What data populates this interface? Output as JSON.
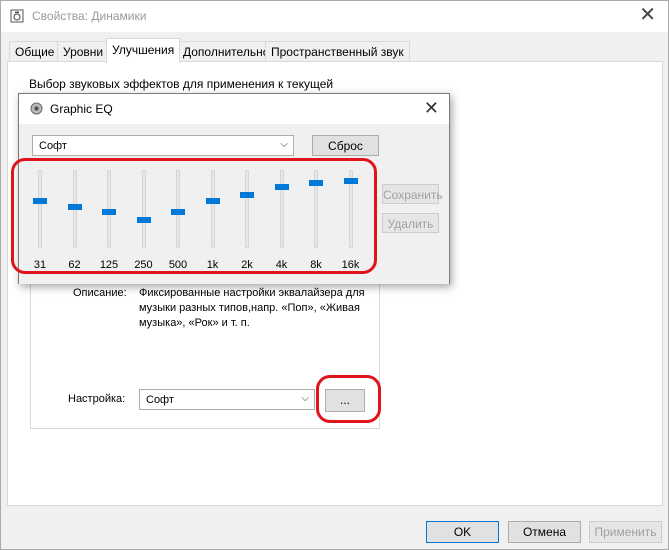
{
  "window": {
    "title": "Свойства: Динамики",
    "tabs": [
      "Общие",
      "Уровни",
      "Улучшения",
      "Дополнительно",
      "Пространственный звук"
    ],
    "active_tab": 2
  },
  "enhancements": {
    "intro": "Выбор звуковых эффектов для применения к текущей",
    "description_label": "Описание:",
    "description_text": "Фиксированные настройки эквалайзера для музыки разных типов,напр. «Поп», «Живая музыка», «Рок» и т. п.",
    "setting_label": "Настройка:",
    "setting_value": "Софт",
    "more_button": "..."
  },
  "equalizer": {
    "title": "Graphic EQ",
    "preset": "Софт",
    "reset_button": "Сброс",
    "save_button": "Сохранить",
    "delete_button": "Удалить",
    "bands": [
      "31",
      "62",
      "125",
      "250",
      "500",
      "1k",
      "2k",
      "4k",
      "8k",
      "16k"
    ],
    "levels": [
      0.6,
      0.52,
      0.46,
      0.36,
      0.46,
      0.6,
      0.68,
      0.78,
      0.83,
      0.86
    ]
  },
  "footer": {
    "ok": "OK",
    "cancel": "Отмена",
    "apply": "Применить"
  },
  "colors": {
    "accent": "#0078d7",
    "highlight_ring": "#e0151b"
  }
}
